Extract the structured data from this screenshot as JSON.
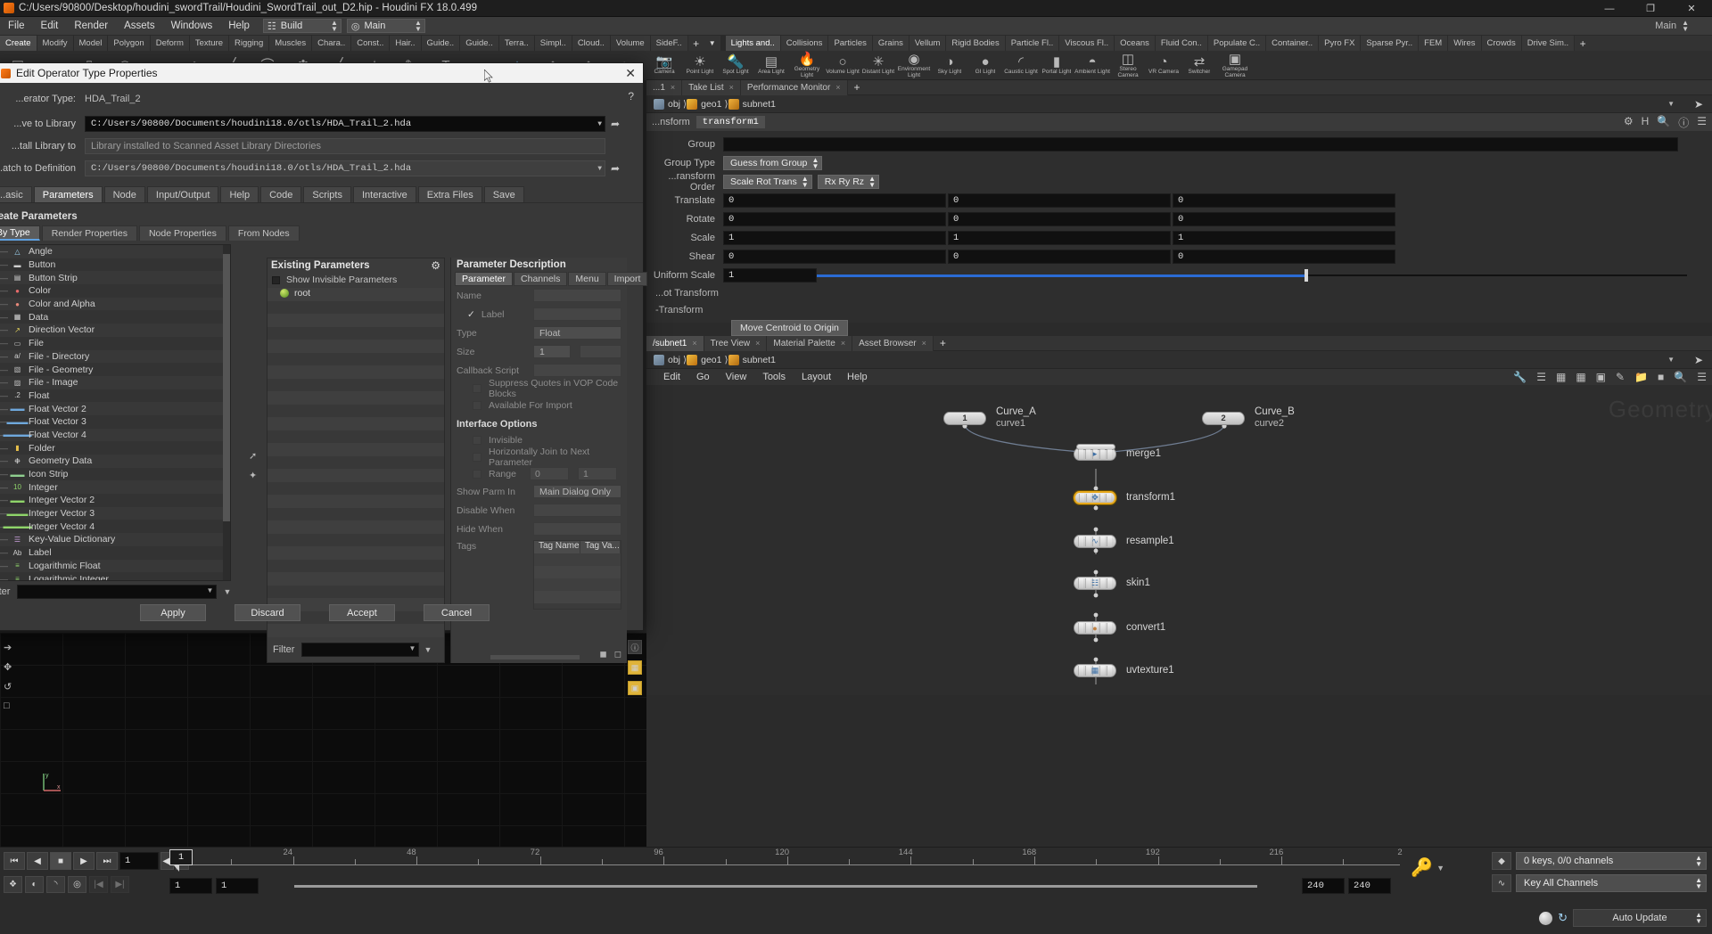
{
  "titlebar": {
    "path": "C:/Users/90800/Desktop/houdini_swordTrail/Houdini_SwordTrail_out_D2.hip - Houdini FX 18.0.499",
    "minimize": "—",
    "maximize": "❐",
    "close": "✕"
  },
  "menubar": {
    "items": [
      "File",
      "Edit",
      "Render",
      "Assets",
      "Windows",
      "Help"
    ],
    "desktop_left": "Build",
    "desktop_right": "Main",
    "right_label": "Main"
  },
  "shelf_left_tabs": [
    "Create",
    "Modify",
    "Model",
    "Polygon",
    "Deform",
    "Texture",
    "Rigging",
    "Muscles",
    "Chara..",
    "Const..",
    "Hair..",
    "Guide..",
    "Guide..",
    "Terra..",
    "Simpl..",
    "Cloud..",
    "Volume",
    "SideF.."
  ],
  "shelf_right_tabs": [
    "Lights and..",
    "Collisions",
    "Particles",
    "Grains",
    "Vellum",
    "Rigid Bodies",
    "Particle Fl..",
    "Viscous Fl..",
    "Oceans",
    "Fluid Con..",
    "Populate C..",
    "Container..",
    "Pyro FX",
    "Sparse Pyr..",
    "FEM",
    "Wires",
    "Crowds",
    "Drive Sim.."
  ],
  "shelf_right_icons": [
    {
      "label": "Camera",
      "glyph": "📷"
    },
    {
      "label": "Point Light",
      "glyph": "☀"
    },
    {
      "label": "Spot Light",
      "glyph": "🔦"
    },
    {
      "label": "Area Light",
      "glyph": "▤"
    },
    {
      "label": "Geometry Light",
      "glyph": "🔥"
    },
    {
      "label": "Volume Light",
      "glyph": "○"
    },
    {
      "label": "Distant Light",
      "glyph": "✳"
    },
    {
      "label": "Environment Light",
      "glyph": "◉"
    },
    {
      "label": "Sky Light",
      "glyph": "◑"
    },
    {
      "label": "GI Light",
      "glyph": "●"
    },
    {
      "label": "Caustic Light",
      "glyph": "◜"
    },
    {
      "label": "Portal Light",
      "glyph": "▮"
    },
    {
      "label": "Ambient Light",
      "glyph": "◓"
    },
    {
      "label": "Stereo Camera",
      "glyph": "◫"
    },
    {
      "label": "VR Camera",
      "glyph": "◔"
    },
    {
      "label": "Switcher",
      "glyph": "⇄"
    },
    {
      "label": "Gamepad Camera",
      "glyph": "▣"
    }
  ],
  "param_pane": {
    "tabs": [
      {
        "label": "...1",
        "active": false,
        "closable": true
      },
      {
        "label": "Take List",
        "active": false,
        "closable": true
      },
      {
        "label": "Performance Monitor",
        "active": false,
        "closable": true
      }
    ],
    "plus": "+",
    "breadcrumb": [
      "obj",
      "geo1",
      "subnet1"
    ],
    "header_type": "...nsform",
    "header_name": "transform1",
    "rows": {
      "group_label": "Group",
      "group_value": "",
      "group_type_label": "Group Type",
      "group_type_value": "Guess from Group",
      "transform_order_label": "...ransform Order",
      "transform_order_srt": "Scale Rot Trans",
      "transform_order_rot": "Rx Ry Rz",
      "translate_label": "Translate",
      "translate": [
        "0",
        "0",
        "0"
      ],
      "rotate_label": "Rotate",
      "rotate": [
        "0",
        "0",
        "0"
      ],
      "scale_label": "Scale",
      "scale": [
        "1",
        "1",
        "1"
      ],
      "shear_label": "Shear",
      "shear": [
        "0",
        "0",
        "0"
      ],
      "uniform_scale_label": "Uniform Scale",
      "uniform_scale": "1",
      "pivot_transform_label": "...ot Transform",
      "pre_transform_label": "-Transform",
      "move_centroid_button": "Move Centroid to Origin"
    }
  },
  "network_pane": {
    "tabs": [
      {
        "label": "/subnet1",
        "active": true,
        "closable": true
      },
      {
        "label": "Tree View",
        "active": false,
        "closable": true
      },
      {
        "label": "Material Palette",
        "active": false,
        "closable": true
      },
      {
        "label": "Asset Browser",
        "active": false,
        "closable": true
      }
    ],
    "plus": "+",
    "breadcrumb": [
      "obj",
      "geo1",
      "subnet1"
    ],
    "menu": [
      "Edit",
      "Go",
      "View",
      "Tools",
      "Layout",
      "Help"
    ],
    "watermark": "Geometry",
    "nodes": [
      {
        "name": "Curve_A",
        "sub": "curve1",
        "badge": "1",
        "selected": false,
        "kind": "curve"
      },
      {
        "name": "Curve_B",
        "sub": "curve2",
        "badge": "2",
        "selected": false,
        "kind": "curve"
      },
      {
        "name": "merge1",
        "sub": "",
        "badge": "",
        "selected": false,
        "kind": "merge"
      },
      {
        "name": "transform1",
        "sub": "",
        "badge": "",
        "selected": true,
        "kind": "transform"
      },
      {
        "name": "resample1",
        "sub": "",
        "badge": "",
        "selected": false,
        "kind": "resample"
      },
      {
        "name": "skin1",
        "sub": "",
        "badge": "",
        "selected": false,
        "kind": "skin"
      },
      {
        "name": "convert1",
        "sub": "",
        "badge": "",
        "selected": false,
        "kind": "convert"
      },
      {
        "name": "uvtexture1",
        "sub": "",
        "badge": "",
        "selected": false,
        "kind": "uv"
      }
    ]
  },
  "dialog": {
    "title": "Edit Operator Type Properties",
    "close": "✕",
    "operator_type_label": "...erator Type:",
    "operator_type_value": "HDA_Trail_2",
    "save_to_library_label": "...ve to Library",
    "save_to_library_value": "C:/Users/90800/Documents/houdini18.0/otls/HDA_Trail_2.hda",
    "install_library_label": "...tall Library to",
    "install_library_value": "Library installed to Scanned Asset Library Directories",
    "match_definition_label": "...atch to Definition",
    "match_definition_value": "C:/Users/90800/Documents/houdini18.0/otls/HDA_Trail_2.hda",
    "help_icon": "?",
    "tabs": [
      "...asic",
      "Parameters",
      "Node",
      "Input/Output",
      "Help",
      "Code",
      "Scripts",
      "Interactive",
      "Extra Files",
      "Save"
    ],
    "active_tab": "Parameters",
    "create_parameters_title": "Create Parameters",
    "subtabs": [
      "By Type",
      "Render Properties",
      "Node Properties",
      "From Nodes"
    ],
    "active_subtab": "By Type",
    "param_types": [
      {
        "label": "Angle",
        "icon": "△",
        "color": "#9fd6f5"
      },
      {
        "label": "Button",
        "icon": "▬",
        "color": "#cfcfcf"
      },
      {
        "label": "Button Strip",
        "icon": "▤",
        "color": "#cfcfcf"
      },
      {
        "label": "Color",
        "icon": "●",
        "color": "#e86b6b"
      },
      {
        "label": "Color and Alpha",
        "icon": "●",
        "color": "#e8897a"
      },
      {
        "label": "Data",
        "icon": "▦",
        "color": "#d8d8d8"
      },
      {
        "label": "Direction Vector",
        "icon": "↗",
        "color": "#e6d45a"
      },
      {
        "label": "File",
        "icon": "▭",
        "color": "#d2d2d2"
      },
      {
        "label": "File - Directory",
        "icon": "a/",
        "color": "#d2d2d2"
      },
      {
        "label": "File - Geometry",
        "icon": "▧",
        "color": "#bfbfbf"
      },
      {
        "label": "File - Image",
        "icon": "▨",
        "color": "#bfbfbf"
      },
      {
        "label": "Float",
        "icon": ".2",
        "color": "#cfcfcf"
      },
      {
        "label": "Float Vector 2",
        "icon": "▬▬",
        "color": "#6fa8dc"
      },
      {
        "label": "Float Vector 3",
        "icon": "▬▬▬",
        "color": "#6fa8dc"
      },
      {
        "label": "Float Vector 4",
        "icon": "▬▬▬▬",
        "color": "#6fa8dc"
      },
      {
        "label": "Folder",
        "icon": "▮",
        "color": "#e8c04a"
      },
      {
        "label": "Geometry Data",
        "icon": "❉",
        "color": "#d8d8d8"
      },
      {
        "label": "Icon Strip",
        "icon": "▬▬",
        "color": "#8fcf8f"
      },
      {
        "label": "Integer",
        "icon": "10",
        "color": "#8fd46a"
      },
      {
        "label": "Integer Vector 2",
        "icon": "▬▬",
        "color": "#8fd46a"
      },
      {
        "label": "Integer Vector 3",
        "icon": "▬▬▬",
        "color": "#8fd46a"
      },
      {
        "label": "Integer Vector 4",
        "icon": "▬▬▬▬",
        "color": "#8fd46a"
      },
      {
        "label": "Key-Value Dictionary",
        "icon": "☰",
        "color": "#c9a0dc"
      },
      {
        "label": "Label",
        "icon": "Ab",
        "color": "#cfcfcf"
      },
      {
        "label": "Logarithmic Float",
        "icon": "≡",
        "color": "#8fd46a"
      },
      {
        "label": "Logarithmic Integer",
        "icon": "≡",
        "color": "#8fd46a"
      }
    ],
    "filter_label": "Filter",
    "filter_value": "",
    "existing": {
      "title": "Existing Parameters",
      "gear_icon": "⚙",
      "show_invisible_label": "Show Invisible Parameters",
      "root_label": "root",
      "filter_label": "Filter",
      "filter_value": ""
    },
    "description": {
      "title": "Parameter Description",
      "tabs": [
        "Parameter",
        "Channels",
        "Menu",
        "Import"
      ],
      "active_tab": "Parameter",
      "name_label": "Name",
      "name_value": "",
      "label_label": "Label",
      "label_value": "",
      "label_checked": true,
      "type_label": "Type",
      "type_value": "Float",
      "size_label": "Size",
      "size_value": "1",
      "callback_label": "Callback Script",
      "callback_value": "",
      "suppress_quotes_label": "Suppress Quotes in VOP Code Blocks",
      "available_import_label": "Available For Import",
      "interface_options_title": "Interface Options",
      "invisible_label": "Invisible",
      "horizontal_join_label": "Horizontally Join to Next Parameter",
      "range_label": "Range",
      "range_min": "0",
      "range_max": "1",
      "show_parm_in_label": "Show Parm In",
      "show_parm_in_value": "Main Dialog Only",
      "disable_when_label": "Disable When",
      "disable_when_value": "",
      "hide_when_label": "Hide When",
      "hide_when_value": "",
      "tags_label": "Tags",
      "tag_name_col": "Tag Name",
      "tag_value_col": "Tag Va..."
    },
    "buttons": [
      "Apply",
      "Discard",
      "Accept",
      "Cancel"
    ]
  },
  "playbar": {
    "transport": [
      "⏮",
      "◀",
      "■",
      "▶",
      "⏭"
    ],
    "current_frame": "1",
    "step_back": "◀|",
    "step_fwd": "|▶",
    "tools2": [
      "❖",
      "◐",
      "◝",
      "◎"
    ],
    "tools2_disabled": [
      "|◀",
      "▶|"
    ],
    "ruler_ticks": [
      "1",
      "24",
      "48",
      "72",
      "96",
      "120",
      "144",
      "168",
      "192",
      "216",
      "2"
    ],
    "playhead_frame": "1",
    "range_start": "1",
    "range_start2": "1",
    "range_end": "240",
    "range_end2": "240",
    "keys_status": "0 keys, 0/0 channels",
    "key_mode": "Key All Channels",
    "auto_update": "Auto Update"
  }
}
